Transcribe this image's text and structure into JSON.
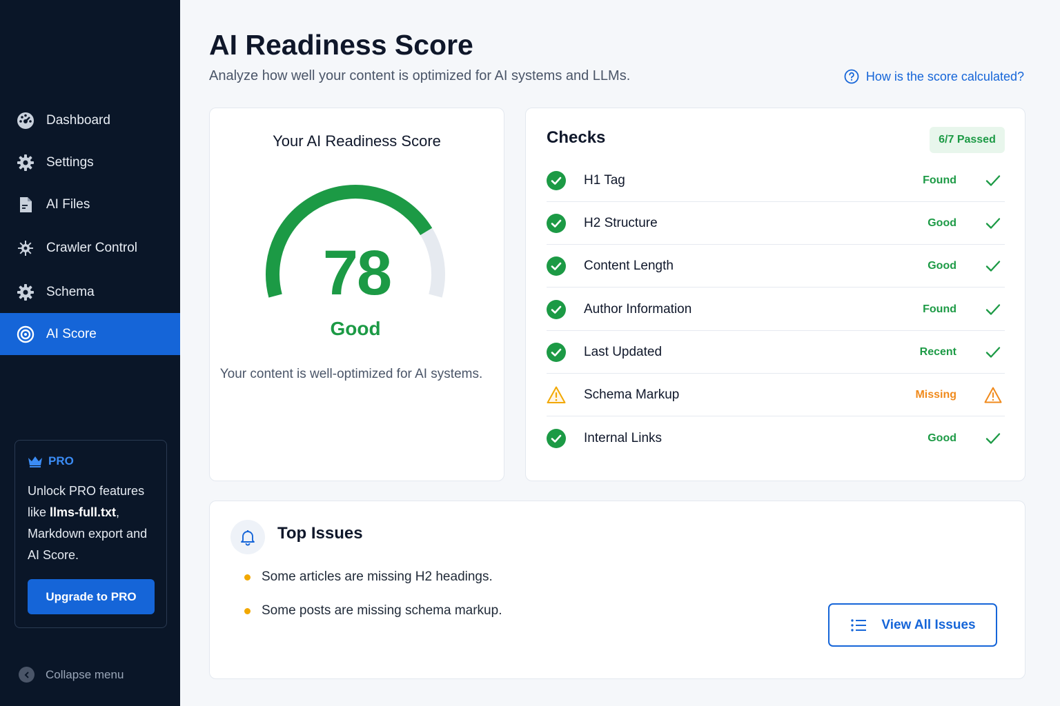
{
  "sidebar": {
    "items": [
      {
        "label": "Dashboard",
        "icon": "dashboard-icon",
        "active": false
      },
      {
        "label": "Settings",
        "icon": "gear-icon",
        "active": false
      },
      {
        "label": "AI Files",
        "icon": "file-icon",
        "active": false
      },
      {
        "label": "Crawler Control",
        "icon": "crawler-icon",
        "active": false
      },
      {
        "label": "Schema",
        "icon": "gear-icon",
        "active": false
      },
      {
        "label": "AI Score",
        "icon": "target-icon",
        "active": true
      }
    ],
    "pro": {
      "badge": "PRO",
      "text_1": "Unlock PRO features like ",
      "text_bold": "llms-full.txt",
      "text_2": ", Markdown export and AI Score.",
      "button": "Upgrade to PRO"
    },
    "collapse_label": "Collapse menu"
  },
  "header": {
    "title": "AI Readiness Score",
    "subtitle": "Analyze how well your content is optimized for AI systems and LLMs.",
    "help_link": "How is the score calculated?"
  },
  "score": {
    "card_title": "Your AI Readiness Score",
    "value": "78",
    "value_fraction": 0.78,
    "label": "Good",
    "description": "Your content is well-optimized for AI systems."
  },
  "checks": {
    "title": "Checks",
    "passed": "6/7 Passed",
    "rows": [
      {
        "name": "H1 Tag",
        "status": "Found",
        "state": "ok"
      },
      {
        "name": "H2 Structure",
        "status": "Good",
        "state": "ok"
      },
      {
        "name": "Content Length",
        "status": "Good",
        "state": "ok"
      },
      {
        "name": "Author Information",
        "status": "Found",
        "state": "ok"
      },
      {
        "name": "Last Updated",
        "status": "Recent",
        "state": "ok"
      },
      {
        "name": "Schema Markup",
        "status": "Missing",
        "state": "warn"
      },
      {
        "name": "Internal Links",
        "status": "Good",
        "state": "ok"
      }
    ]
  },
  "issues": {
    "title": "Top Issues",
    "items": [
      "Some articles are missing H2 headings.",
      "Some posts are missing schema markup."
    ],
    "button": "View All Issues"
  },
  "colors": {
    "accent": "#1565d8",
    "success": "#1c9a45",
    "warning": "#f08a1c",
    "sidebar_bg": "#0a1628"
  }
}
